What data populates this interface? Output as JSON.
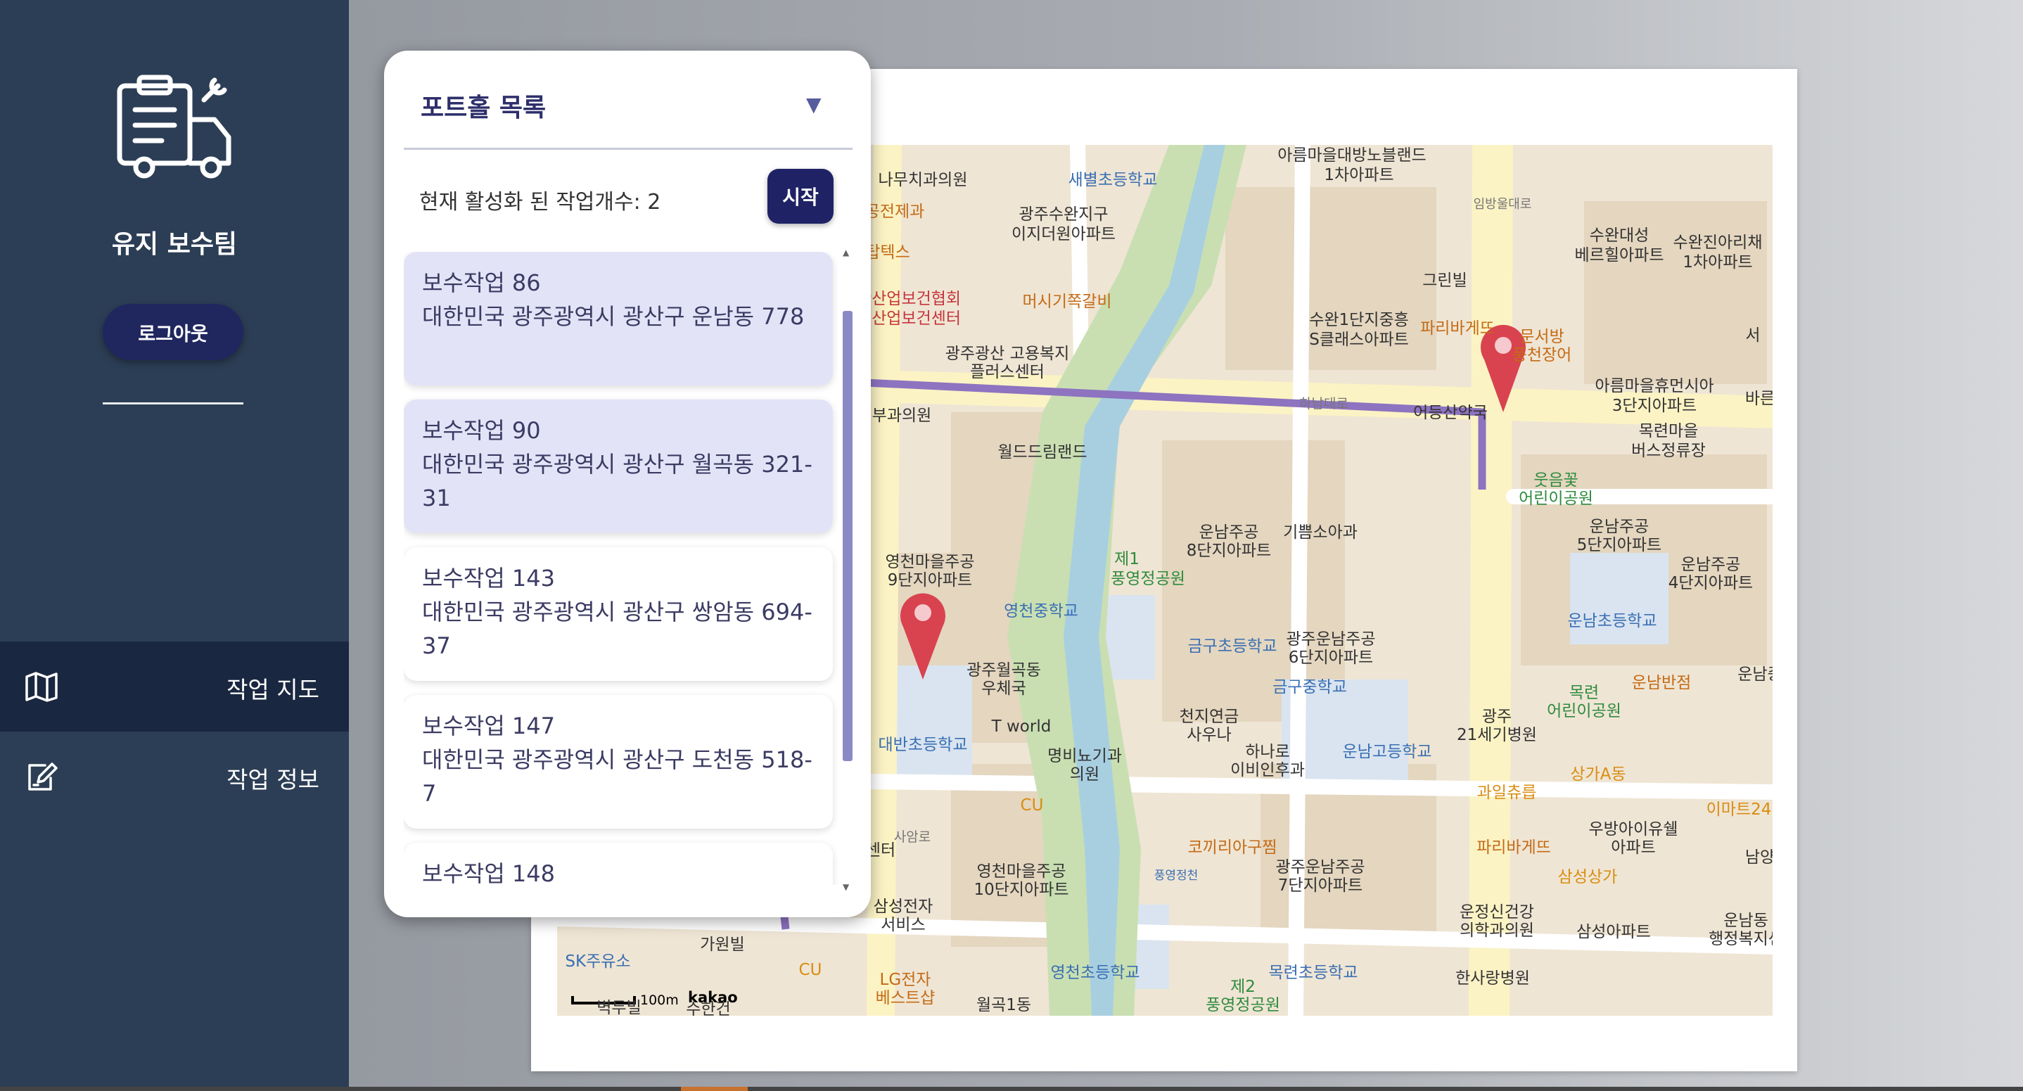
{
  "sidebar": {
    "team_name": "유지 보수팀",
    "logout_label": "로그아웃",
    "nav": [
      {
        "label": "작업 지도",
        "icon": "map-icon",
        "active": true
      },
      {
        "label": "작업 정보",
        "icon": "edit-icon",
        "active": false
      }
    ]
  },
  "panel": {
    "title": "포트홀 목록",
    "toggle_icon": "▼",
    "active_count": "현재 활성화 된 작업개수: 2",
    "start_label": "시작",
    "jobs": [
      {
        "title": "보수작업 86",
        "address": "대한민국 광주광역시 광산구 운남동 778",
        "selected": true
      },
      {
        "title": "보수작업 90",
        "address": "대한민국 광주광역시 광산구 월곡동 321-31",
        "selected": true
      },
      {
        "title": "보수작업 143",
        "address": "대한민국 광주광역시 광산구 쌍암동 694-37",
        "selected": false
      },
      {
        "title": "보수작업 147",
        "address": "대한민국 광주광역시 광산구 도천동 518-7",
        "selected": false
      },
      {
        "title": "보수작업 148",
        "address": "",
        "selected": false
      }
    ]
  },
  "map": {
    "scale_label": "100m",
    "provider": "kakao",
    "labels": {
      "l1": "아름마을대방노블랜드",
      "l2": "1차아파트",
      "l3": "나무치과의원",
      "l4": "새별초등학교",
      "l5": "광주수완지구",
      "l6": "이지더원아파트",
      "l7": "수완대성",
      "l8": "베르힐아파트",
      "l9": "수완진아리채",
      "l10": "1차아파트",
      "l11": "그린빌",
      "l12": "머시기쪽갈비",
      "l13": "한산업보건협회",
      "l14": "주산업보건센터",
      "l15": "수완1단지중흥",
      "l16": "S클래스아파트",
      "l17": "파리바게뜨",
      "l18": "풍천장어",
      "l19": "광주광산 고용복지",
      "l20": "플러스센터",
      "l21": "아름마을휴먼시아",
      "l22": "3단지아파트",
      "l23": "하남대로",
      "l24": "어등산약국",
      "l25": "목련마을",
      "l26": "버스정류장",
      "l27": "부과의원",
      "l28": "월드드림랜드",
      "l29": "웃음꽃",
      "l30": "어린이공원",
      "l31": "운남주공",
      "l32": "8단지아파트",
      "l33": "기쁨소아과",
      "l34": "운남주공",
      "l35": "5단지아파트",
      "l36": "영천마을주공",
      "l37": "9단지아파트",
      "l38": "제1",
      "l39": "풍영정공원",
      "l40": "운남주공",
      "l41": "4단지아파트",
      "l42": "영천중학교",
      "l43": "금구초등학교",
      "l44": "광주운남주공",
      "l45": "6단지아파트",
      "l46": "운남초등학교",
      "l47": "광주월곡동",
      "l48": "우체국",
      "l49": "금구중학교",
      "l50": "목련",
      "l51": "어린이공원",
      "l52": "운남반점",
      "l53": "천지연금",
      "l54": "사우나",
      "l55": "T world",
      "l56": "광주",
      "l57": "21세기병원",
      "l58": "대반초등학교",
      "l59": "명비뇨기과",
      "l60": "의원",
      "l61": "하나로",
      "l62": "이비인후과",
      "l63": "운남고등학교",
      "l64": "CU",
      "l65": "과일츄릅",
      "l66": "상가A동",
      "l67": "이마트24",
      "l68": "우방아이유쉘",
      "l69": "아파트",
      "l70": "사암로",
      "l71": "센터",
      "l72": "코끼리아구찜",
      "l73": "파리바게뜨",
      "l74": "영천마을주공",
      "l75": "10단지아파트",
      "l76": "광주운남주공",
      "l77": "7단지아파트",
      "l78": "삼성상가",
      "l79": "남양",
      "l80": "삼성전자",
      "l81": "서비스",
      "l82": "운정신건강",
      "l83": "의학과의원",
      "l84": "삼성아파트",
      "l85": "운남동",
      "l86": "행정복지센",
      "l87": "SK주유소",
      "l88": "가원빌",
      "l89": "CU",
      "l90": "영천초등학교",
      "l91": "목련초등학교",
      "l92": "제2",
      "l93": "풍영정공원",
      "l94": "LG전자",
      "l95": "베스트샵",
      "l96": "월곡1동",
      "l97": "한사랑병원",
      "l98": "벽두빌",
      "l99": "수한건",
      "l100": "운남중",
      "l101": "바른",
      "l102": "공전제과",
      "l103": "탑텍스",
      "l104": "임방울대로",
      "l105": "풍영정천",
      "l106": "문서방",
      "l107": "서"
    }
  },
  "colors": {
    "sidebar": "#2c3e55",
    "sidebar_active": "#1a2740",
    "button_navy": "#1f2365",
    "selected_card": "#e3e3f8",
    "route": "#8d73c0",
    "marker": "#d8434f"
  }
}
